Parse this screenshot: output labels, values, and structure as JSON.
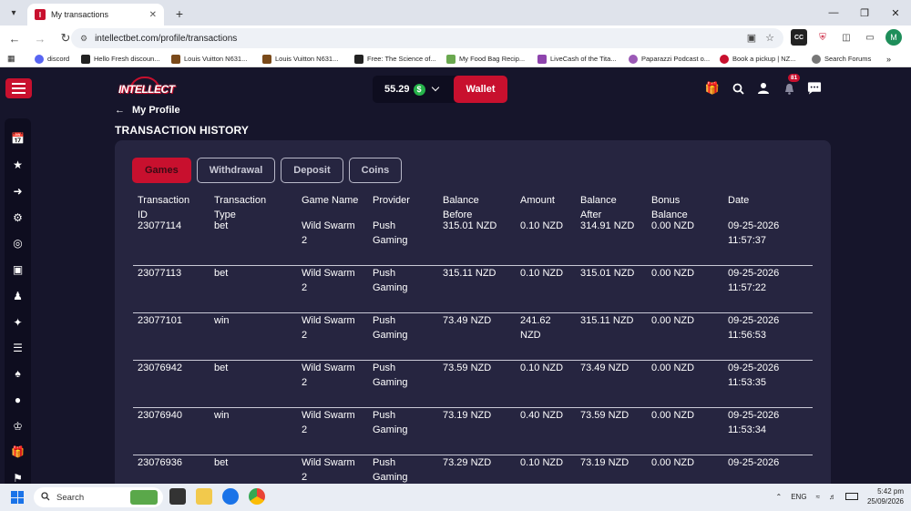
{
  "browser": {
    "tab_title": "My transactions",
    "url": "intellectbet.com/profile/transactions",
    "bookmarks": [
      {
        "label": "discord",
        "color": "#5865f2"
      },
      {
        "label": "Hello Fresh discoun...",
        "color": "#222222"
      },
      {
        "label": "Louis Vuitton N631...",
        "color": "#7a4a1a"
      },
      {
        "label": "Louis Vuitton N631...",
        "color": "#7a4a1a"
      },
      {
        "label": "Free: The Science of...",
        "color": "#222222"
      },
      {
        "label": "My Food Bag Recip...",
        "color": "#6aa84f"
      },
      {
        "label": "LiveCash of the Tita...",
        "color": "#8e44ad"
      },
      {
        "label": "Paparazzi Podcast o...",
        "color": "#9b59b6"
      },
      {
        "label": "Book a pickup | NZ...",
        "color": "#c8102e"
      },
      {
        "label": "Search Forums",
        "color": "#777777"
      }
    ]
  },
  "header": {
    "balance": "55.29",
    "currency_icon": "$",
    "wallet_label": "Wallet",
    "notification_count": "81"
  },
  "page": {
    "back_label": "My Profile",
    "title": "TRANSACTION HISTORY"
  },
  "filters": [
    "Games",
    "Withdrawal",
    "Deposit",
    "Coins"
  ],
  "columns": {
    "transaction_id": [
      "Transaction",
      "ID"
    ],
    "transaction_type": [
      "Transaction",
      "Type"
    ],
    "game_name": [
      "Game Name",
      ""
    ],
    "provider": [
      "Provider",
      ""
    ],
    "balance_before": [
      "Balance",
      "Before"
    ],
    "amount": [
      "Amount",
      ""
    ],
    "balance_after": [
      "Balance",
      "After"
    ],
    "bonus_balance": [
      "Bonus",
      "Balance"
    ],
    "date": [
      "Date",
      ""
    ]
  },
  "rows": [
    {
      "id": "23077114",
      "type": "bet",
      "game": [
        "Wild Swarm",
        "2"
      ],
      "provider": [
        "Push",
        "Gaming"
      ],
      "before": [
        "315.01 NZD",
        ""
      ],
      "amount": [
        "0.10 NZD",
        ""
      ],
      "after": "314.91 NZD",
      "bonus": "0.00 NZD",
      "date": [
        "09-25-2026",
        "11:57:37"
      ]
    },
    {
      "id": "23077113",
      "type": "bet",
      "game": [
        "Wild Swarm",
        "2"
      ],
      "provider": [
        "Push",
        "Gaming"
      ],
      "before": [
        "315.11 NZD",
        ""
      ],
      "amount": [
        "0.10 NZD",
        ""
      ],
      "after": "315.01 NZD",
      "bonus": "0.00 NZD",
      "date": [
        "09-25-2026",
        "11:57:22"
      ]
    },
    {
      "id": "23077101",
      "type": "win",
      "game": [
        "Wild Swarm",
        "2"
      ],
      "provider": [
        "Push",
        "Gaming"
      ],
      "before": [
        "73.49 NZD",
        ""
      ],
      "amount": [
        "241.62",
        "NZD"
      ],
      "after": "315.11 NZD",
      "bonus": "0.00 NZD",
      "date": [
        "09-25-2026",
        "11:56:53"
      ]
    },
    {
      "id": "23076942",
      "type": "bet",
      "game": [
        "Wild Swarm",
        "2"
      ],
      "provider": [
        "Push",
        "Gaming"
      ],
      "before": [
        "73.59 NZD",
        ""
      ],
      "amount": [
        "0.10 NZD",
        ""
      ],
      "after": "73.49 NZD",
      "bonus": "0.00 NZD",
      "date": [
        "09-25-2026",
        "11:53:35"
      ]
    },
    {
      "id": "23076940",
      "type": "win",
      "game": [
        "Wild Swarm",
        "2"
      ],
      "provider": [
        "Push",
        "Gaming"
      ],
      "before": [
        "73.19 NZD",
        ""
      ],
      "amount": [
        "0.40 NZD",
        ""
      ],
      "after": "73.59 NZD",
      "bonus": "0.00 NZD",
      "date": [
        "09-25-2026",
        "11:53:34"
      ]
    },
    {
      "id": "23076936",
      "type": "bet",
      "game": [
        "Wild Swarm",
        "2"
      ],
      "provider": [
        "Push",
        "Gaming"
      ],
      "before": [
        "73.29 NZD",
        ""
      ],
      "amount": [
        "0.10 NZD",
        ""
      ],
      "after": "73.19 NZD",
      "bonus": "0.00 NZD",
      "date": [
        "09-25-2026",
        ""
      ]
    }
  ],
  "taskbar": {
    "search_placeholder": "Search",
    "language": "ENG",
    "time": "5:42 pm",
    "date": "25/09/2026"
  },
  "colors": {
    "accent": "#c8102e",
    "background": "#16152b",
    "panel": "#262540"
  }
}
